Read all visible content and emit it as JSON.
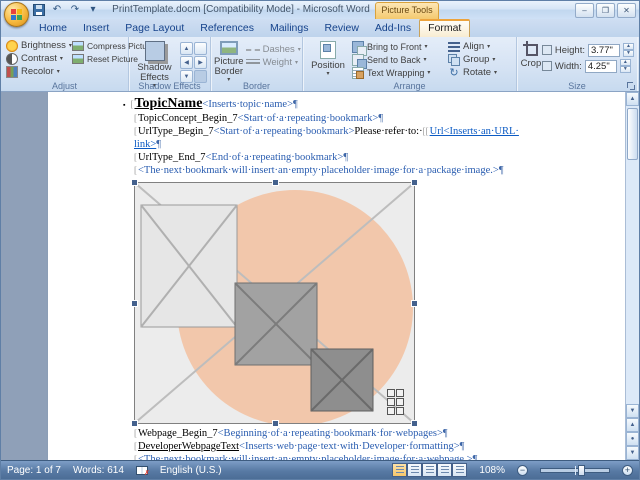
{
  "window": {
    "title": "PrintTemplate.docm [Compatibility Mode] - Microsoft Word",
    "tools_label": "Picture Tools"
  },
  "glyphs": {
    "dropdown": "▾",
    "up": "▲",
    "down": "▼",
    "undo": "↶",
    "redo": "↷",
    "minimize": "–",
    "maximize": "❐",
    "close": "✕",
    "browse_dot": "●",
    "rotate": "↻",
    "minus": "−",
    "plus": "+",
    "error_mark": "✗"
  },
  "tabs": [
    {
      "label": "Home"
    },
    {
      "label": "Insert"
    },
    {
      "label": "Page Layout"
    },
    {
      "label": "References"
    },
    {
      "label": "Mailings"
    },
    {
      "label": "Review"
    },
    {
      "label": "Add-Ins"
    },
    {
      "label": "Format",
      "active": true
    }
  ],
  "ribbon": {
    "adjust": {
      "brightness": "Brightness",
      "contrast": "Contrast",
      "recolor": "Recolor",
      "compress": "Compress Pictures",
      "reset": "Reset Picture",
      "label": "Adjust"
    },
    "shadow": {
      "button": "Shadow Effects",
      "label": "Shadow Effects"
    },
    "border": {
      "picture_border": "Picture Border",
      "dashes": "Dashes",
      "weight": "Weight",
      "label": "Border"
    },
    "arrange": {
      "position": "Position",
      "bring_front": "Bring to Front",
      "send_back": "Send to Back",
      "text_wrap": "Text Wrapping",
      "align": "Align",
      "group": "Group",
      "rotate": "Rotate",
      "label": "Arrange"
    },
    "size": {
      "crop": "Crop",
      "height_label": "Height:",
      "height_value": "3.77\"",
      "width_label": "Width:",
      "width_value": "4.25\"",
      "label": "Size"
    }
  },
  "document": {
    "lines_before": [
      {
        "cls": "h",
        "segments": [
          {
            "style": "bullet",
            "text": "▪"
          },
          {
            "style": "bm",
            "text": "["
          },
          {
            "style": "nameBig",
            "text": "TopicName"
          },
          {
            "style": "desc",
            "text": "<Inserts·topic·name>"
          },
          {
            "style": "pil",
            "text": "¶"
          }
        ]
      },
      {
        "segments": [
          {
            "style": "bm",
            "text": "["
          },
          {
            "style": "plain",
            "text": "TopicConcept_Begin_7"
          },
          {
            "style": "desc",
            "text": "<Start·of·a·repeating·bookmark>"
          },
          {
            "style": "pil",
            "text": "¶"
          }
        ]
      },
      {
        "segments": [
          {
            "style": "bm",
            "text": "["
          },
          {
            "style": "plain",
            "text": "UrlType_Begin_7"
          },
          {
            "style": "desc",
            "text": "<Start·of·a·repeating·bookmark>"
          },
          {
            "style": "plain",
            "text": "Please·refer·to:·"
          },
          {
            "style": "bm",
            "text": "[["
          },
          {
            "style": "link",
            "text": "Url<Inserts·an·URL·"
          }
        ]
      },
      {
        "segments": [
          {
            "style": "link",
            "text": "link>"
          },
          {
            "style": "pil",
            "text": "¶"
          }
        ]
      },
      {
        "segments": [
          {
            "style": "bm",
            "text": "["
          },
          {
            "style": "plain",
            "text": "UrlType_End_7"
          },
          {
            "style": "desc",
            "text": "<End·of·a·repeating·bookmark>"
          },
          {
            "style": "pil",
            "text": "¶"
          }
        ]
      },
      {
        "segments": [
          {
            "style": "bm",
            "text": "["
          },
          {
            "style": "desc",
            "text": "<The·next·bookmark·will·insert·an·empty·placeholder·image·for·a·package·image.>"
          },
          {
            "style": "pil",
            "text": "¶"
          }
        ]
      }
    ],
    "lines_after": [
      {
        "segments": [
          {
            "style": "bm",
            "text": "["
          },
          {
            "style": "plain",
            "text": "Webpage_Begin_7"
          },
          {
            "style": "desc",
            "text": "<Beginning·of·a·repeating·bookmark·for·webpages>"
          },
          {
            "style": "pil",
            "text": "¶"
          }
        ]
      },
      {
        "segments": [
          {
            "style": "bm",
            "text": "["
          },
          {
            "style": "nameU",
            "text": "DeveloperWebpageText"
          },
          {
            "style": "desc",
            "text": "<Inserts·web·page·text·with·Developer·formatting>"
          },
          {
            "style": "pil",
            "text": "¶"
          }
        ]
      },
      {
        "segments": [
          {
            "style": "bm",
            "text": "["
          },
          {
            "style": "desc",
            "text": "<The·next·bookmark·will·insert·an·empty·placeholder·image·for·a·webpage.>"
          },
          {
            "style": "pil",
            "text": "¶"
          }
        ]
      }
    ]
  },
  "statusbar": {
    "page": "Page: 1 of 7",
    "words": "Words: 614",
    "language": "English (U.S.)",
    "zoom": "108%"
  },
  "theme": {
    "contextual_orange": "#f4c96f",
    "status_blue": "#587aa4",
    "placeholder_peach": "#f2c7ab"
  }
}
